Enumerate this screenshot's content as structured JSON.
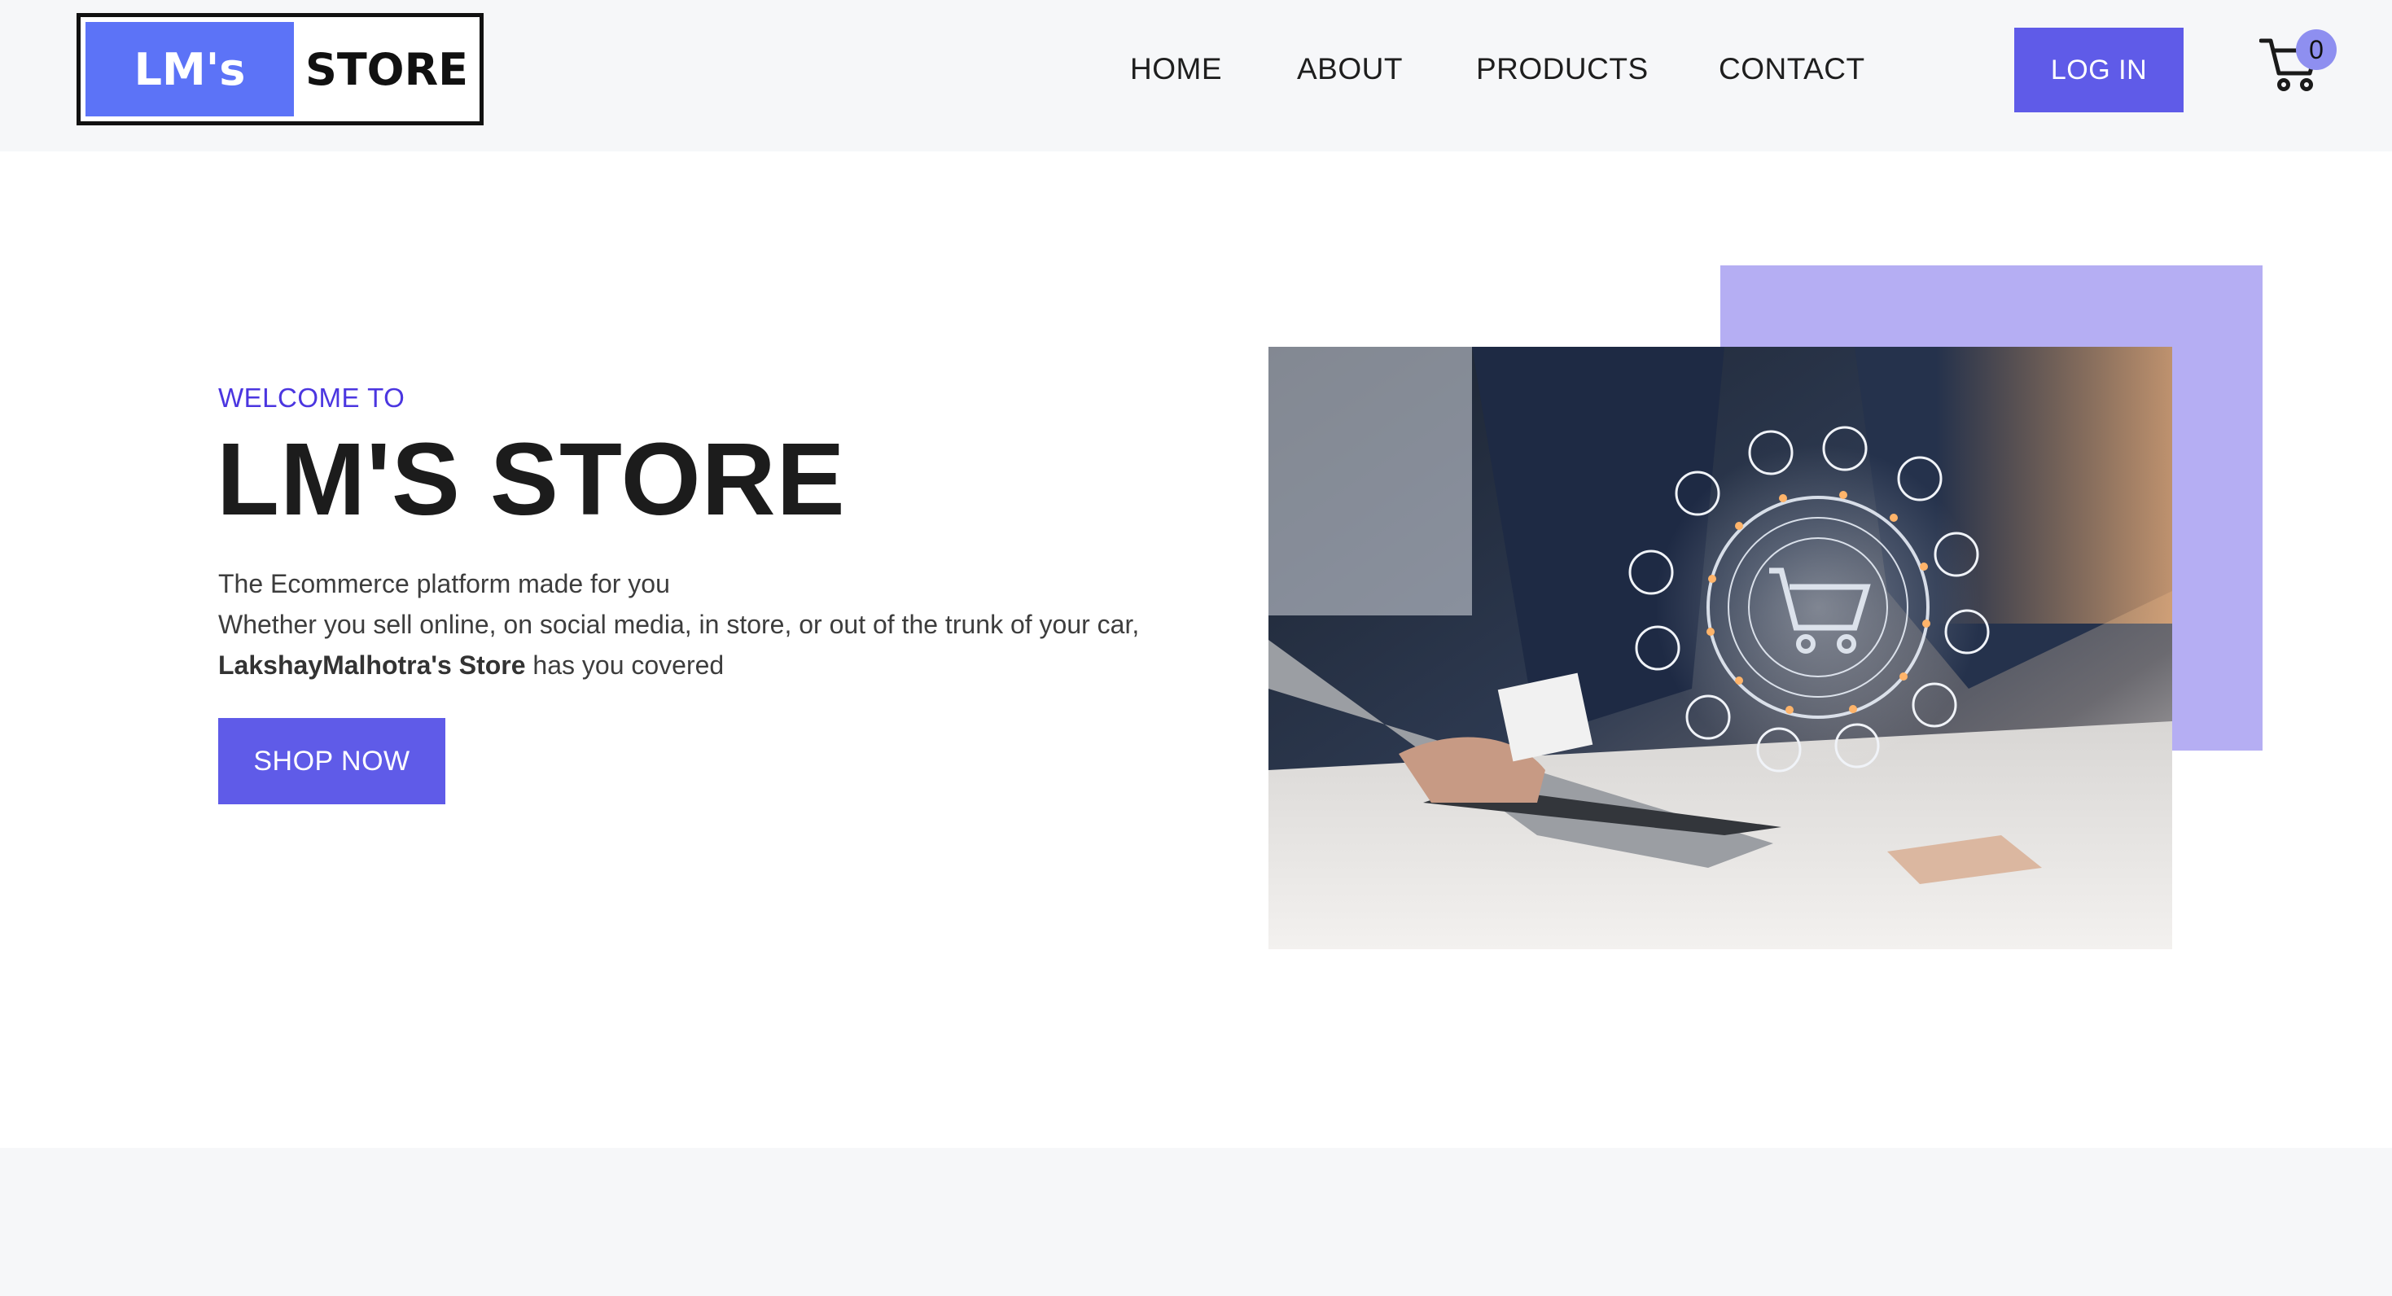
{
  "header": {
    "logo": {
      "left": "LM's",
      "right": "STORE"
    },
    "nav": [
      {
        "label": "HOME"
      },
      {
        "label": "ABOUT"
      },
      {
        "label": "PRODUCTS"
      },
      {
        "label": "CONTACT"
      }
    ],
    "login_label": "LOG IN",
    "cart_count": "0"
  },
  "hero": {
    "eyebrow": "WELCOME TO",
    "title": "LM'S STORE",
    "line1": "The Ecommerce platform made for you",
    "line2_start": "Whether you sell online, on social media, in store, or out of the trunk of your car, ",
    "line2_bold": "LakshayMalhotra's Store",
    "line2_end": " has you covered",
    "cta_label": "SHOP NOW"
  },
  "colors": {
    "accent": "#5f5be8",
    "eyebrow": "#4b36e0",
    "logo_blue": "#5c73f7",
    "accent_block": "#b5aef3",
    "badge": "#8e8ff0",
    "header_bg": "#f6f7f9"
  },
  "icons": [
    "cart-icon",
    "ecommerce-photo"
  ]
}
